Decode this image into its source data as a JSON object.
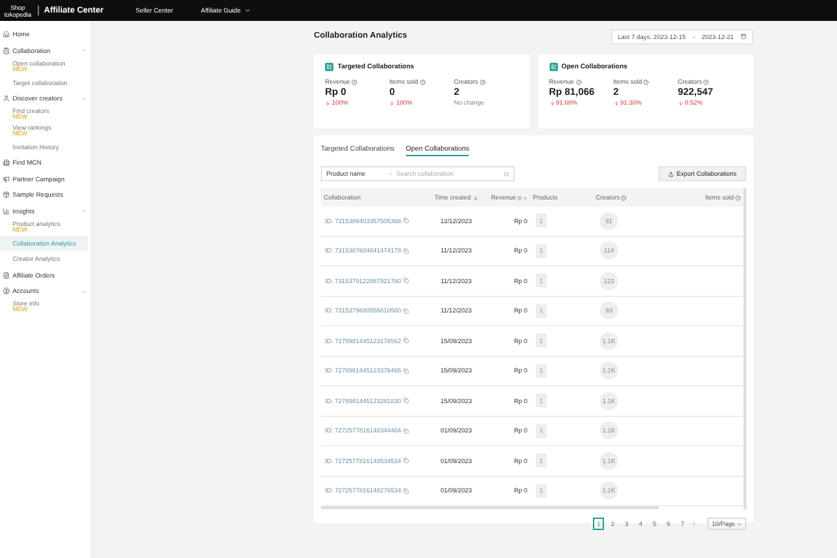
{
  "header": {
    "logo_top": "Shop",
    "logo_bottom": "tokopedia",
    "title": "Affiliate Center",
    "links": [
      {
        "label": "Seller Center"
      },
      {
        "label": "Affiliate Guide",
        "dropdown": true
      }
    ]
  },
  "sidebar": {
    "items": [
      {
        "label": "Home"
      },
      {
        "label": "Collaboration",
        "expanded": true,
        "children": [
          {
            "label": "Open collaboration",
            "badge": "NEW",
            "selected": false
          },
          {
            "label": "Target collaboration",
            "selected": false
          }
        ]
      },
      {
        "label": "Discover creators",
        "expanded": true,
        "children": [
          {
            "label": "Find creators",
            "badge": "NEW",
            "selected": false
          },
          {
            "label": "View rankings",
            "badge": "NEW",
            "selected": false
          },
          {
            "label": "Invitation History",
            "selected": false
          }
        ]
      },
      {
        "label": "Find MCN"
      },
      {
        "label": "Partner Campaign"
      },
      {
        "label": "Sample Requests"
      },
      {
        "label": "Insights",
        "expanded": true,
        "children": [
          {
            "label": "Product analytics",
            "badge": "NEW",
            "selected": false
          },
          {
            "label": "Collaboration Analytics",
            "selected": true
          },
          {
            "label": "Creator Analytics",
            "selected": false
          }
        ]
      },
      {
        "label": "Affiliate Orders"
      },
      {
        "label": "Accounts",
        "expanded": true,
        "children": [
          {
            "label": "Store info",
            "badge": "NEW",
            "selected": false
          }
        ]
      }
    ]
  },
  "page": {
    "title": "Collaboration Analytics",
    "date_range": {
      "start": "Last 7 days: 2023-12-15",
      "separator": "-",
      "end": "2023-12-21"
    }
  },
  "cards": [
    {
      "title": "Targeted Collaborations",
      "stats": [
        {
          "label": "Revenue",
          "value": "Rp 0",
          "down": true,
          "change": "100%"
        },
        {
          "label": "Items sold",
          "value": "0",
          "down": true,
          "change": "100%"
        },
        {
          "label": "Creators",
          "value": "2",
          "down": false,
          "change": "No change"
        }
      ]
    },
    {
      "title": "Open Collaborations",
      "stats": [
        {
          "label": "Revenue",
          "value": "Rp 81,066",
          "down": true,
          "change": "91.68%"
        },
        {
          "label": "Items sold",
          "value": "2",
          "down": true,
          "change": "91.30%"
        },
        {
          "label": "Creators",
          "value": "922,547",
          "down": true,
          "change": "0.52%"
        }
      ]
    }
  ],
  "tabs": [
    {
      "label": "Targeted Collaborations",
      "selected": false
    },
    {
      "label": "Open Collaborations",
      "selected": true
    }
  ],
  "filter": {
    "field": "Product name",
    "placeholder": "Search collaboration"
  },
  "export_button": "Export Collaborations",
  "table": {
    "columns": [
      {
        "label": "Collaboration"
      },
      {
        "label": "Time created",
        "sort": true
      },
      {
        "label": "Revenue",
        "help": true,
        "sort": true
      },
      {
        "label": "Products"
      },
      {
        "label": "Creators",
        "help": true
      },
      {
        "label": "Items sold",
        "help": true
      }
    ],
    "rows": [
      {
        "id": "ID: 7315389403357505368",
        "time": "12/12/2023",
        "revenue": "Rp 0",
        "products": "1",
        "creators": "91"
      },
      {
        "id": "ID: 7315387604841474178",
        "time": "11/12/2023",
        "revenue": "Rp 0",
        "products": "1",
        "creators": "114"
      },
      {
        "id": "ID: 7315379122867921760",
        "time": "11/12/2023",
        "revenue": "Rp 0",
        "products": "1",
        "creators": "123"
      },
      {
        "id": "ID: 7315379680556810560",
        "time": "11/12/2023",
        "revenue": "Rp 0",
        "products": "1",
        "creators": "93"
      },
      {
        "id": "ID: 7278981445123178562",
        "time": "15/09/2023",
        "revenue": "Rp 0",
        "products": "1",
        "creators": "1.1K"
      },
      {
        "id": "ID: 7278981445123376466",
        "time": "15/09/2023",
        "revenue": "Rp 0",
        "products": "1",
        "creators": "1.1K"
      },
      {
        "id": "ID: 7278981445123281830",
        "time": "15/09/2023",
        "revenue": "Rp 0",
        "products": "1",
        "creators": "1.1K"
      },
      {
        "id": "ID: 7272577816148344464",
        "time": "01/09/2023",
        "revenue": "Rp 0",
        "products": "1",
        "creators": "1.1K"
      },
      {
        "id": "ID: 7272577816148534534",
        "time": "01/09/2023",
        "revenue": "Rp 0",
        "products": "1",
        "creators": "1.1K"
      },
      {
        "id": "ID: 7272577816148276534",
        "time": "01/09/2023",
        "revenue": "Rp 0",
        "products": "1",
        "creators": "1.1K"
      }
    ]
  },
  "pagination": {
    "pages": [
      {
        "label": "1",
        "selected": true
      },
      {
        "label": "2",
        "selected": false
      },
      {
        "label": "3",
        "selected": false
      },
      {
        "label": "4",
        "selected": false
      },
      {
        "label": "5",
        "selected": false
      },
      {
        "label": "6",
        "selected": false
      },
      {
        "label": "7",
        "selected": false
      }
    ],
    "page_size": "10/Page"
  }
}
